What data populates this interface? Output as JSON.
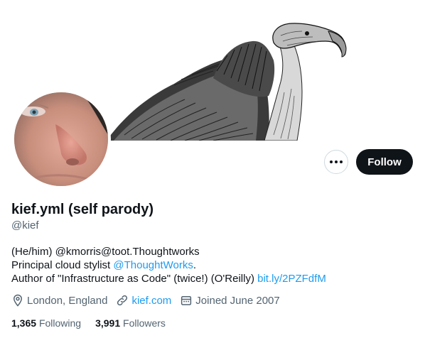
{
  "banner": {
    "image": "vulture-illustration"
  },
  "profile": {
    "avatar": "profile-photo",
    "name": "kief.yml (self parody)",
    "handle": "@kief",
    "bio": {
      "line1": "(He/him) @kmorris@toot.Thoughtworks",
      "line2_prefix": "Principal cloud stylist ",
      "line2_link": "@ThoughtWorks",
      "line2_suffix": ".",
      "line3_prefix": "Author of \"Infrastructure as Code\" (twice!) (O'Reilly) ",
      "line3_link": "bit.ly/2PZFdfM"
    },
    "location": "London, England",
    "website": "kief.com",
    "joined": "Joined June 2007",
    "following_count": "1,365",
    "following_label": "Following",
    "followers_count": "3,991",
    "followers_label": "Followers"
  },
  "actions": {
    "more_icon": "more-horizontal-icon",
    "follow_label": "Follow"
  },
  "colors": {
    "text": "#0f1419",
    "secondary": "#536471",
    "link": "#1d9bf0",
    "follow_bg": "#0f1419"
  }
}
